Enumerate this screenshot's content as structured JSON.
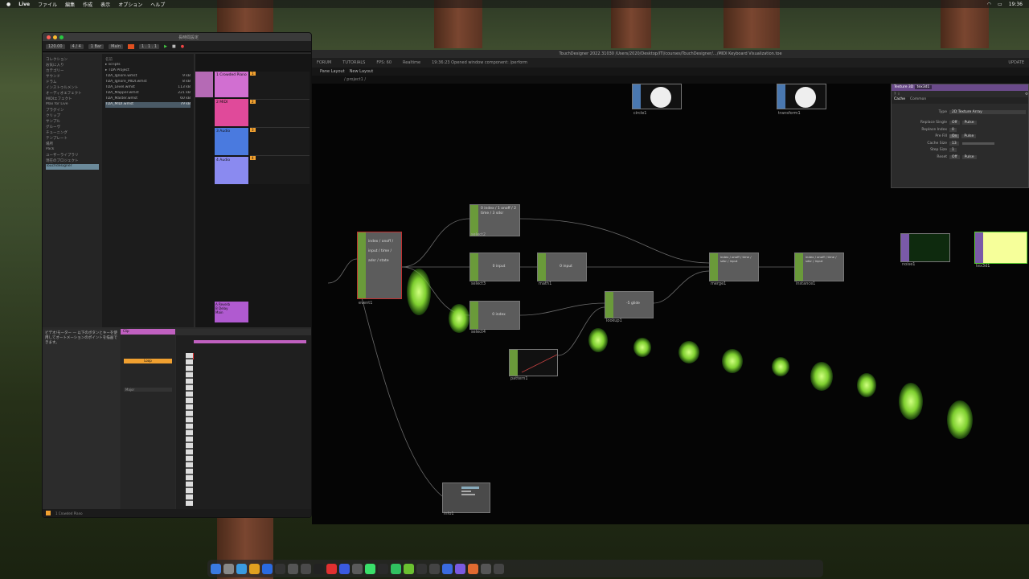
{
  "menubar": {
    "app": "Live",
    "items": [
      "ファイル",
      "編集",
      "作成",
      "表示",
      "オプション",
      "ヘルプ"
    ],
    "time": "19:36"
  },
  "ableton": {
    "title": "長時間設定",
    "toolbar": {
      "tempo": "120.00",
      "signature": "4 / 4",
      "bar": "1 Bar",
      "key": "Main",
      "position": "1 . 1 . 1"
    },
    "browser": {
      "header": "コレクション",
      "items": [
        "お気に入り",
        "カテゴリー",
        "サウンド",
        "ドラム",
        "インストゥルメント",
        "オーディオエフェクト",
        "MIDIエフェクト",
        "Max for Live",
        "プラグイン",
        "クリップ",
        "サンプル",
        "グルーヴ",
        "チューニング",
        "テンプレート",
        "場所",
        "Pack",
        "ユーザーライブラリ",
        "現在のプロジェクト",
        "Touchdesigner"
      ],
      "selected": "Touchdesigner"
    },
    "files": {
      "header": "名前",
      "items": [
        "scripts",
        "TDA Project",
        "TDA_Ignore.wmst",
        "TDA_Ignore_MIDI.wmst",
        "TDA_Level.wmst",
        "TDA_Mapper.wmst",
        "TDA_Master.wmst",
        "TDA_MIDI.wmst"
      ],
      "sizes": [
        "",
        "",
        "9 kB",
        "8 kB",
        "113 kB",
        "221 kB",
        "60 kB",
        "79 kB"
      ],
      "selected": "TDA_MIDI.wmst"
    },
    "tracks": [
      {
        "name": "1 Crowded Piano",
        "color": "#d16fd1"
      },
      {
        "name": "2 MIDI",
        "color": "#e04a9a"
      },
      {
        "name": "3 Audio",
        "color": "#4a7adf"
      },
      {
        "name": "4 Audio",
        "color": "#8a8af0"
      }
    ],
    "returns": [
      "A Reverb",
      "B Delay",
      "Main"
    ],
    "clip_panel": {
      "title": "Clip",
      "loop": "Loop",
      "scale": "Major"
    },
    "status": "1 Crowded Piano",
    "info_text": "ビデオ/モーター — 以下のボタンとキーを使用してオートメーションのポイントを描画できます。"
  },
  "td": {
    "title": "TouchDesigner 2022.31030 /Users/2020/Desktop/ITI/courses/TouchDesigner/…/MIDI Keyboard Visualization.toe",
    "menu": [
      "FORUM",
      "TUTORIALS",
      "FPS: 60",
      "Realtime",
      "19:36:23 Opened window component: /perform"
    ],
    "update_label": "UPDATE",
    "tabs": [
      "Pane Layout",
      "New Layout"
    ],
    "path": "/ project1 /",
    "nodes": [
      {
        "name": "circle1",
        "kind": "top"
      },
      {
        "name": "transform1",
        "kind": "top"
      },
      {
        "name": "select2",
        "kind": "chop",
        "text": "0 index / 1 onoff / 2 time / 3 sdsr"
      },
      {
        "name": "select3",
        "kind": "chop",
        "text": "0 input"
      },
      {
        "name": "math1",
        "kind": "chop",
        "text": "0 input"
      },
      {
        "name": "merge1",
        "kind": "chop",
        "text": "index / onoff / time / sdsr / input"
      },
      {
        "name": "instance1",
        "kind": "chop",
        "text": "index / onoff / time / sdsr / input"
      },
      {
        "name": "event1",
        "kind": "chop",
        "text": "index / onoff / input / time / adsr / state"
      },
      {
        "name": "select4",
        "kind": "chop",
        "text": "0 index"
      },
      {
        "name": "lookup1",
        "kind": "chop",
        "text": "-5 glide"
      },
      {
        "name": "pattern1",
        "kind": "chop",
        "text": ""
      },
      {
        "name": "noise1",
        "kind": "top"
      },
      {
        "name": "tex3d1",
        "kind": "top"
      },
      {
        "name": "info1",
        "kind": "dat"
      }
    ],
    "params": {
      "header_type": "Texture 3D",
      "header_name": "tex3d1",
      "tabs": [
        "Cache",
        "Common"
      ],
      "rows": [
        {
          "label": "Type",
          "value": "2D Texture Array"
        },
        {
          "label": "Replace Single",
          "value": "Off"
        },
        {
          "label": "Replace Index",
          "value": "0"
        },
        {
          "label": "Pre Fill",
          "value": "On"
        },
        {
          "label": "Cache Size",
          "value": "13"
        },
        {
          "label": "Step Size",
          "value": "1"
        },
        {
          "label": "Reset",
          "value": "Off"
        }
      ],
      "pulse": "Pulse"
    }
  },
  "colors": {
    "accent_green": "#6a9a3a",
    "accent_purple": "#7a5aa8",
    "ableton_orange": "#f0a030"
  }
}
